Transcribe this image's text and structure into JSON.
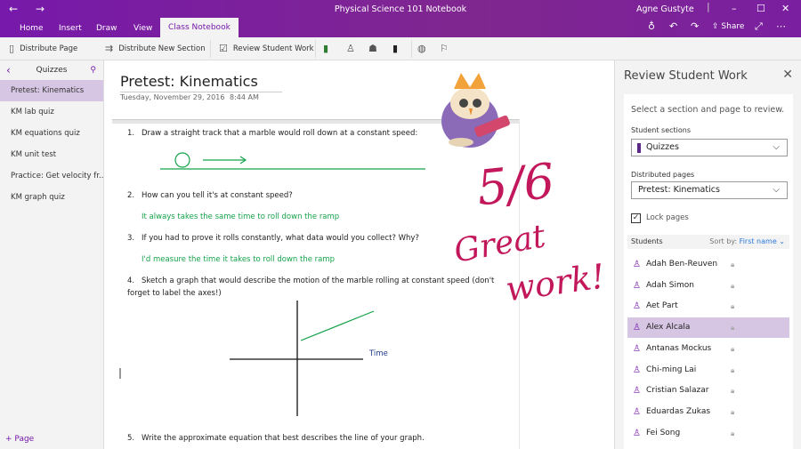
{
  "window": {
    "title": "Physical Science 101 Notebook",
    "user": "Agne Gustyte"
  },
  "tabs": [
    "Home",
    "Insert",
    "Draw",
    "View",
    "Class Notebook"
  ],
  "title_actions": {
    "share": "Share"
  },
  "ribbon": {
    "distribute_page": "Distribute Page",
    "distribute_section": "Distribute New Section",
    "review": "Review Student Work"
  },
  "sidebar": {
    "section": "Quizzes",
    "pages": [
      "Pretest: Kinematics",
      "KM lab quiz",
      "KM equations quiz",
      "KM unit test",
      "Practice: Get velocity fr...",
      "KM graph quiz"
    ],
    "add_page": "Page"
  },
  "page": {
    "title": "Pretest: Kinematics",
    "date": "Tuesday, November 29, 2016",
    "time": "8:44 AM",
    "questions": [
      {
        "n": "1.",
        "text": "Draw a straight track that a marble would roll down at a constant speed:"
      },
      {
        "n": "2.",
        "text": "How can you tell it's at constant speed?",
        "answer": "It always takes the same time to roll down the ramp"
      },
      {
        "n": "3.",
        "text": "If you had to prove it rolls constantly, what data would you collect? Why?",
        "answer": "I'd measure the time it takes to roll down the ramp"
      },
      {
        "n": "4.",
        "text": "Sketch a graph that would describe the motion of the marble rolling at constant speed (don't forget to label the axes!)"
      },
      {
        "n": "5.",
        "text": "Write the approximate equation that best describes the line of your graph."
      }
    ],
    "graph_label": "Time",
    "ink": {
      "score": "5/6",
      "line1": "Great",
      "line2": "work!",
      "color": "#c2185b"
    },
    "ink_color": "#16a34a"
  },
  "panel": {
    "title": "Review Student Work",
    "hint": "Select a section and page to review.",
    "sections_label": "Student sections",
    "section_value": "Quizzes",
    "pages_label": "Distributed pages",
    "page_value": "Pretest: Kinematics",
    "lock_label": "Lock pages",
    "lock_checked": true,
    "students_label": "Students",
    "sort_label": "Sort by:",
    "sort_value": "First name",
    "students": [
      "Adah Ben-Reuven",
      "Adah Simon",
      "Aet Part",
      "Alex Alcala",
      "Antanas Mockus",
      "Chi-ming Lai",
      "Cristian Salazar",
      "Eduardas Zukas",
      "Fei Song"
    ],
    "selected_student": "Alex Alcala"
  },
  "colors": {
    "accent": "#7719aa",
    "selection": "#d7c6e3"
  }
}
